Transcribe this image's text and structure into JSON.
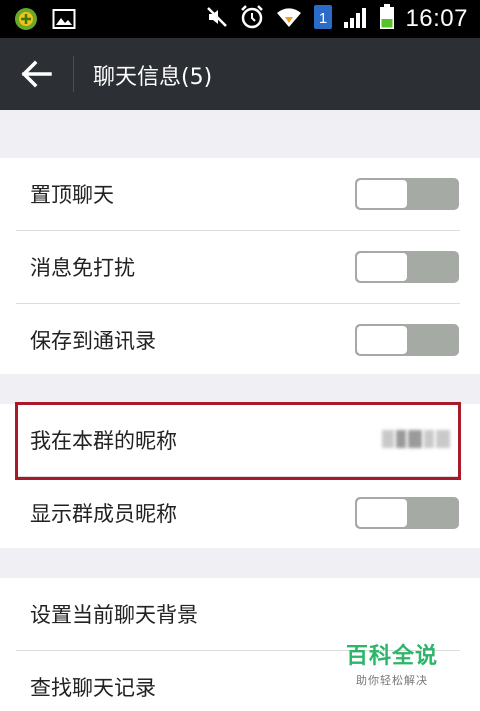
{
  "status_bar": {
    "time": "16:07",
    "sim_badge": "1",
    "icons": [
      "app-notification-icon",
      "image-notification-icon",
      "mute-icon",
      "alarm-icon",
      "wifi-icon",
      "sim-icon",
      "signal-icon",
      "battery-icon"
    ]
  },
  "action_bar": {
    "title": "聊天信息(5)",
    "back_icon": "arrow-left-icon"
  },
  "settings": {
    "pin_chat": {
      "label": "置顶聊天",
      "on": false
    },
    "do_not_disturb": {
      "label": "消息免打扰",
      "on": false
    },
    "save_to_contacts": {
      "label": "保存到通讯录",
      "on": false
    },
    "my_group_nickname": {
      "label": "我在本群的昵称",
      "value": ""
    },
    "show_member_nicknames": {
      "label": "显示群成员昵称",
      "on": false
    },
    "set_chat_background": {
      "label": "设置当前聊天背景"
    },
    "search_chat_history": {
      "label": "查找聊天记录"
    }
  },
  "watermark": {
    "title": "百科全说",
    "subtitle": "助你轻松解决"
  },
  "colors": {
    "action_bar": "#2c2f34",
    "toggle_off": "#a6aaa4",
    "highlight": "#a8192a",
    "watermark": "#2db56a"
  }
}
